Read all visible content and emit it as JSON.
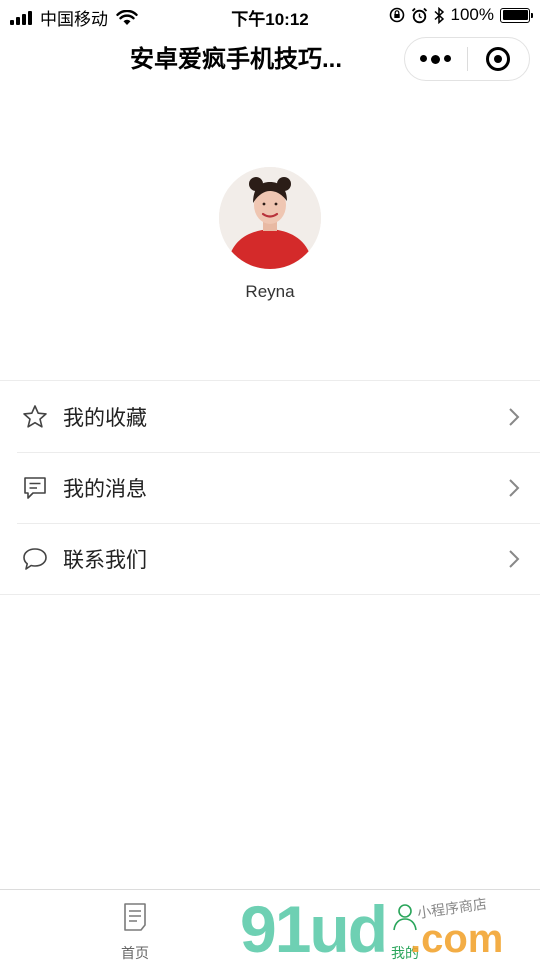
{
  "status_bar": {
    "carrier": "中国移动",
    "time": "下午10:12",
    "battery": "100%"
  },
  "nav": {
    "title": "安卓爱疯手机技巧..."
  },
  "profile": {
    "username": "Reyna"
  },
  "menu": {
    "items": [
      {
        "label": "我的收藏",
        "icon": "star-icon"
      },
      {
        "label": "我的消息",
        "icon": "message-icon"
      },
      {
        "label": "联系我们",
        "icon": "chat-bubble-icon"
      }
    ]
  },
  "tabbar": {
    "tabs": [
      {
        "label": "首页",
        "icon": "home-document-icon"
      },
      {
        "label": "我的",
        "icon": "profile-icon",
        "active": true
      }
    ],
    "active_color": "#2aa55b"
  },
  "watermark": {
    "brand": "91ud",
    "domain": ".com",
    "tagline": "小程序商店"
  },
  "colors": {
    "accent": "#2aa55b",
    "divider": "#ececec",
    "avatar_shirt": "#d42a2a"
  }
}
